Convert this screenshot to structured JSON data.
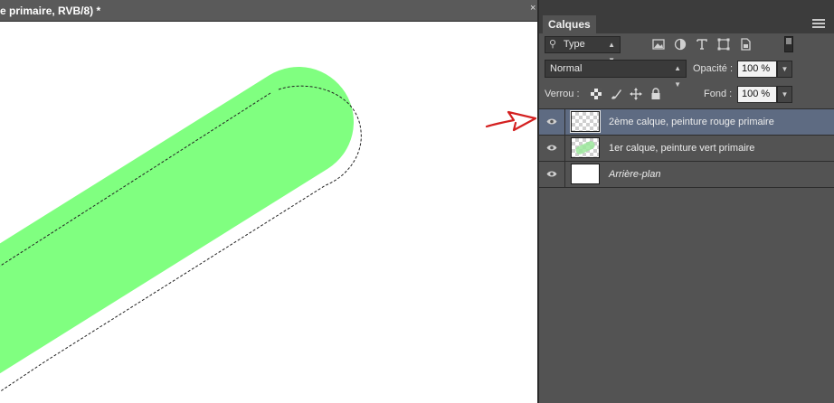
{
  "document": {
    "tab_title": "e primaire, RVB/8) *",
    "close_glyph": "×"
  },
  "colors": {
    "canvas_bg": "#ffffff",
    "paint_stroke": "#80ff80",
    "selection_line": "#222222",
    "annotation_arrow": "#d42020",
    "selected_row": "#5e6b82"
  },
  "panel": {
    "tab_label": "Calques",
    "filter": {
      "lens": "⚲",
      "value": "Type"
    },
    "filter_icons": [
      "image-filter-icon",
      "adjustment-filter-icon",
      "type-filter-icon",
      "shape-filter-icon",
      "smart-object-filter-icon"
    ],
    "blend_mode": "Normal",
    "opacity_label": "Opacité :",
    "opacity_value": "100 %",
    "lock_label": "Verrou :",
    "lock_icons": [
      "lock-transparency-icon",
      "lock-pixels-icon",
      "lock-position-icon",
      "lock-all-icon"
    ],
    "fill_label": "Fond :",
    "fill_value": "100 %",
    "layers": [
      {
        "name": "2ème calque, peinture rouge primaire",
        "visible": true,
        "selected": true
      },
      {
        "name": "1er calque, peinture vert primaire",
        "visible": true,
        "selected": false
      },
      {
        "name": "Arrière-plan",
        "visible": true,
        "selected": false
      }
    ]
  }
}
